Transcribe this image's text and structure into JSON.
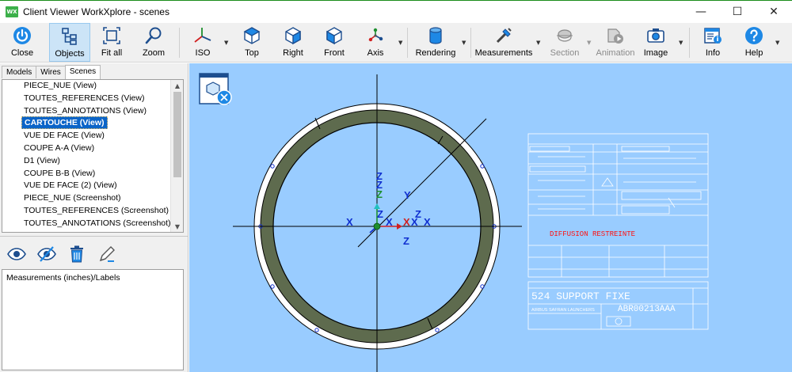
{
  "window": {
    "app_logo": "WX",
    "title": "Client Viewer WorkXplore - scenes",
    "minimize": "—",
    "maximize": "☐",
    "close": "✕"
  },
  "toolbar": {
    "close": "Close",
    "objects": "Objects",
    "fit_all": "Fit all",
    "zoom": "Zoom",
    "iso": "ISO",
    "top": "Top",
    "right": "Right",
    "front": "Front",
    "axis": "Axis",
    "rendering": "Rendering",
    "measurements": "Measurements",
    "section": "Section",
    "animation": "Animation",
    "image": "Image",
    "info": "Info",
    "help": "Help"
  },
  "tabs": [
    "Models",
    "Wires",
    "Scenes"
  ],
  "scenes": [
    "PIECE_NUE (View)",
    "TOUTES_REFERENCES (View)",
    "TOUTES_ANNOTATIONS (View)",
    "CARTOUCHE (View)",
    "VUE DE FACE (View)",
    "COUPE A-A (View)",
    "D1 (View)",
    "COUPE B-B (View)",
    "VUE DE FACE (2) (View)",
    "PIECE_NUE (Screenshot)",
    "TOUTES_REFERENCES (Screenshot)",
    "TOUTES_ANNOTATIONS (Screenshot)"
  ],
  "selected_scene_index": 3,
  "measurements_title": "Measurements (inches)/Labels",
  "viewport": {
    "axis_labels": {
      "z1": "Z",
      "z2": "Z",
      "z3": "Z",
      "z4": "Z",
      "z5": "Z",
      "z6": "Z",
      "y1": "Y",
      "x1": "X",
      "x2": "X",
      "x3": "X",
      "x4": "X",
      "x5": "X"
    },
    "title_block": {
      "diffusion": "DIFFUSION RESTREINTE",
      "part_name": "524 SUPPORT FIXE",
      "company": "AIRBUS SAFRAN LAUNCHERS",
      "drawing_number": "ABR00213AAA"
    },
    "colors": {
      "background": "#99ccff",
      "ring": "#5e6b4e",
      "axis_blue": "#1030d0",
      "restricted": "#ff1010"
    }
  }
}
